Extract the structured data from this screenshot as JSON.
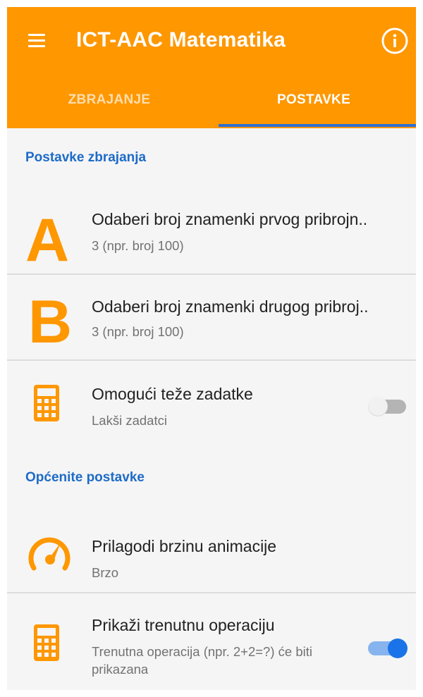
{
  "app": {
    "title": "ICT-AAC Matematika",
    "menu_icon": "hamburger-menu-icon",
    "info_icon": "info-icon"
  },
  "tabs": [
    {
      "label": "ZBRAJANJE",
      "selected": false
    },
    {
      "label": "POSTAVKE",
      "selected": true
    }
  ],
  "sections": {
    "addition": {
      "header": "Postavke zbrajanja",
      "items": [
        {
          "icon": "letter-a-icon",
          "icon_text": "A",
          "title": "Odaberi broj znamenki prvog pribrojn..",
          "subtitle": "3 (npr. broj 100)"
        },
        {
          "icon": "letter-b-icon",
          "icon_text": "B",
          "title": "Odaberi broj znamenki drugog pribroj..",
          "subtitle": "3 (npr. broj 100)"
        },
        {
          "icon": "calculator-icon",
          "title": "Omogući teže zadatke",
          "subtitle": "Lakši zadatci",
          "toggle": false
        }
      ]
    },
    "general": {
      "header": "Općenite postavke",
      "items": [
        {
          "icon": "speedometer-icon",
          "title": "Prilagodi brzinu animacije",
          "subtitle": "Brzo"
        },
        {
          "icon": "calculator-icon",
          "title": "Prikaži trenutnu operaciju",
          "subtitle": "Trenutna operacija (npr. 2+2=?) će biti prikazana",
          "toggle": true
        }
      ]
    }
  },
  "colors": {
    "app_bar": "#fe9700",
    "accent_orange": "#fe9700",
    "section_header": "#1d6bc7",
    "tab_indicator": "#2f6fd1",
    "switch_on": "#1a73e8",
    "switch_off_thumb": "#f1f1f1"
  }
}
